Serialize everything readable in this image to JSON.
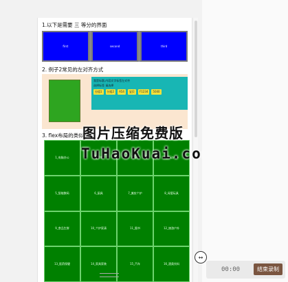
{
  "doc": {
    "heading1": "1.以下是需要 三 等分的界面",
    "boxes": [
      "first",
      "second",
      "third"
    ],
    "heading2": "2. 例子2常见的左对齐方式",
    "ex2_line1": "我是标题,内容文字标签左对齐",
    "ex2_line2": "选择标签 请选择",
    "ex2_tags": [
      "分组1",
      "分组2",
      "A54",
      "宝贝",
      "F1234",
      "5040"
    ],
    "heading3": "3. flex布局的类似网",
    "grid_cells": [
      "1_电脑办公",
      "2_家电",
      "3_服装",
      "4_运动户外",
      "5_智能数码",
      "6_厨具",
      "7_美妆个护",
      "8_母婴玩具",
      "9_食品生鲜",
      "10_个护家清",
      "11_图书",
      "12_旅游户外",
      "13_医药保健",
      "14_家具家装",
      "15_汽车",
      "16_酒类饮料"
    ]
  },
  "watermark": {
    "line1": "图片压缩免费版",
    "line2": "TuHaoKuai.com"
  },
  "recorder": {
    "time": "00:00",
    "stop_label": "结束录制",
    "toggle_icon": "minimize-icon"
  }
}
